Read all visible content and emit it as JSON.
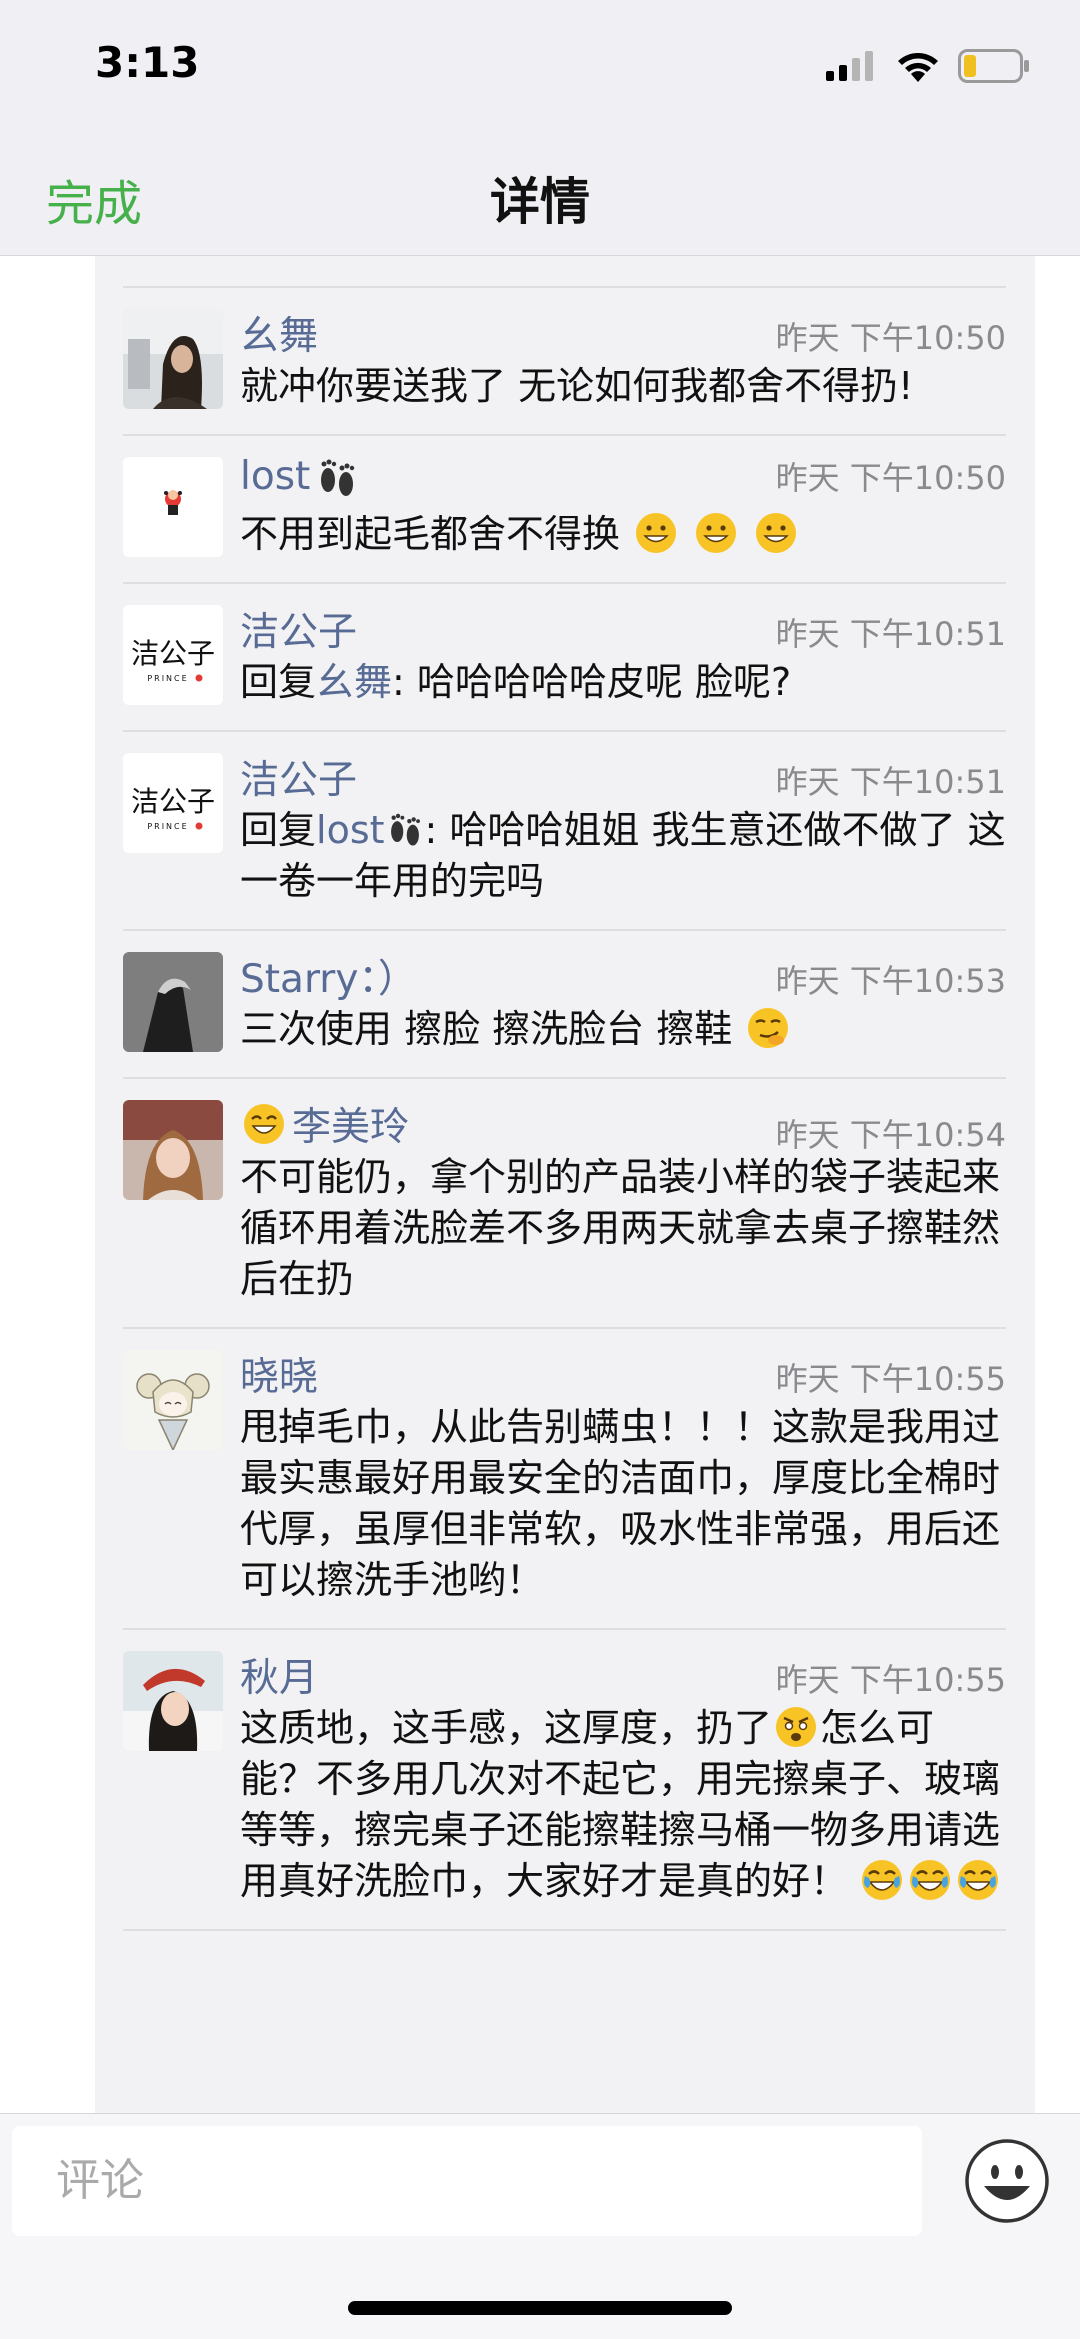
{
  "status_bar": {
    "time": "3:13"
  },
  "nav": {
    "done_label": "完成",
    "title": "详情"
  },
  "comments": [
    {
      "name": "幺舞",
      "time": "昨天 下午10:50",
      "text": "就冲你要送我了 无论如何我都舍不得扔!"
    },
    {
      "name": "lost",
      "time": "昨天 下午10:50",
      "text": "不用到起毛都舍不得换"
    },
    {
      "name": "洁公子",
      "time": "昨天 下午10:51",
      "reply_prefix": "回复",
      "reply_to": "幺舞",
      "text": ": 哈哈哈哈哈皮呢 脸呢?"
    },
    {
      "name": "洁公子",
      "time": "昨天 下午10:51",
      "reply_prefix": "回复",
      "reply_to": "lost",
      "text": ": 哈哈哈姐姐 我生意还做不做了 这一卷一年用的完吗"
    },
    {
      "name": "Starry：）",
      "time": "昨天 下午10:53",
      "text": "三次使用 擦脸 擦洗脸台 擦鞋"
    },
    {
      "name": "李美玲",
      "time": "昨天 下午10:54",
      "text": "不可能仍，拿个别的产品装小样的袋子装起来循环用着洗脸差不多用两天就拿去桌子擦鞋然后在扔"
    },
    {
      "name": "晓晓",
      "time": "昨天 下午10:55",
      "text": "甩掉毛巾，从此告别螨虫！！！这款是我用过最实惠最好用最安全的洁面巾，厚度比全棉时代厚，虽厚但非常软，吸水性非常强，用后还可以擦洗手池哟！"
    },
    {
      "name": "秋月",
      "time": "昨天 下午10:55",
      "text_part1": "这质地，这手感，这厚度，扔了",
      "text_part2": "怎么可能？不多用几次对不起它，用完擦桌子、玻璃等等，擦完桌子还能擦鞋擦马桶一物多用请选用真好洗脸巾，大家好才是真的好！"
    }
  ],
  "avatars": {
    "jie_logo_text": "洁公子",
    "jie_logo_sub": "PRINCE"
  },
  "composer": {
    "placeholder": "评论"
  },
  "colors": {
    "accent_green": "#46b14a",
    "name_blue": "#576b95",
    "time_gray": "#8a8a8e"
  },
  "icons": [
    "cellular-signal-icon",
    "wifi-icon",
    "battery-icon",
    "footprints-icon",
    "grin-emoji",
    "smirk-emoji",
    "angry-emoji",
    "tears-of-joy-emoji",
    "emoji-picker-icon"
  ]
}
